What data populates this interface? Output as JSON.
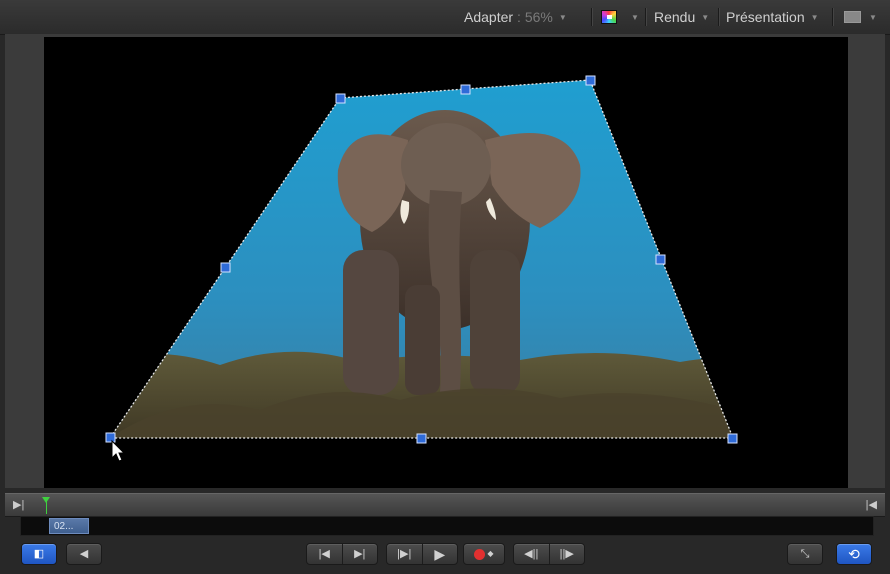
{
  "toolbar": {
    "fit_label": "Adapter",
    "fit_value": ": 56%",
    "render_label": "Rendu",
    "view_label": "Présentation"
  },
  "timeline": {
    "clip_label": "02..."
  },
  "canvas": {
    "image_subject": "elephant",
    "tool": "distort"
  },
  "icons": {
    "color_channels": "color-wheel-icon",
    "display": "display-icon",
    "in_point": "in-point-icon",
    "out_point": "out-point-icon",
    "playhead": "playhead-icon",
    "pointer": "arrow-cursor-icon"
  },
  "transport": {
    "left_group": [
      "layers-toggle",
      "audio-toggle"
    ],
    "center_group": [
      "go-to-start",
      "go-to-end",
      "play-from-in",
      "play",
      "record",
      "step-back",
      "step-forward"
    ],
    "right_group": [
      "fullscreen",
      "loop"
    ]
  },
  "colors": {
    "handle": "#2f6bd8",
    "accent_blue": "#2563d6",
    "playhead": "#3fd13f",
    "record": "#e23030"
  }
}
